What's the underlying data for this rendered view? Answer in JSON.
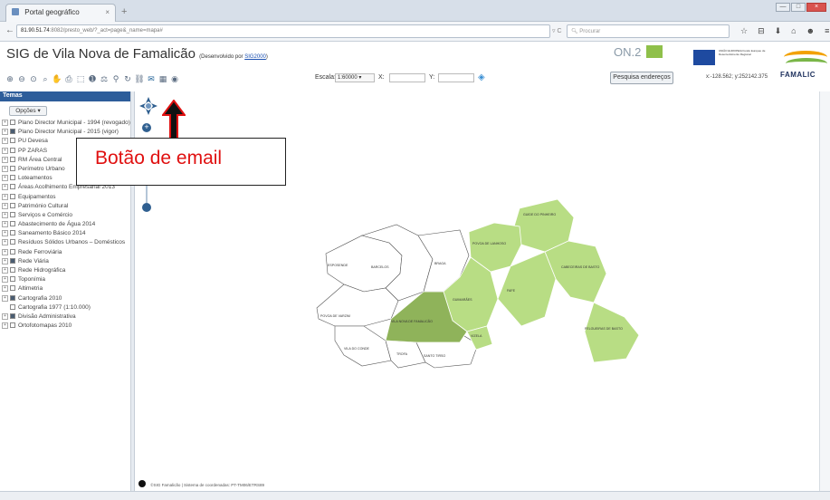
{
  "browser": {
    "tab_title": "Portal geográfico",
    "tab_close": "×",
    "new_tab": "+",
    "back": "←",
    "url_host": "81.90.51.74",
    "url_rest": ":8082/presto_web/?_act=page&_name=mapa#",
    "reload": "▿ C",
    "search_placeholder": "Procurar",
    "nav_icons": [
      "☆",
      "⊟",
      "⬇",
      "⌂",
      "☻",
      "≡"
    ],
    "window_controls": [
      "—",
      "□",
      "×"
    ]
  },
  "header": {
    "title": "SIG de Vila Nova de Famalicão",
    "credit_prefix": "(Desenvolvido por ",
    "credit_link": "SIG2000",
    "credit_suffix": ")",
    "logo_on2": "ON.2",
    "eu_text": "UNIÃO EUROPEIA Fundo Europeu de Desenvolvimento Regional",
    "famalicao_logo_text": "FAMALIC"
  },
  "toolbar": {
    "tools": [
      {
        "name": "zoom-in-tool",
        "glyph": "⊕"
      },
      {
        "name": "zoom-out-tool",
        "glyph": "⊖"
      },
      {
        "name": "zoom-extent-tool",
        "glyph": "⊙"
      },
      {
        "name": "zoom-window-tool",
        "glyph": "⌕"
      },
      {
        "name": "pan-tool",
        "glyph": "✋"
      },
      {
        "name": "print-tool",
        "glyph": "⎙"
      },
      {
        "name": "layer-tool",
        "glyph": "⬚"
      },
      {
        "name": "info-tool",
        "glyph": "➊"
      },
      {
        "name": "measure-tool",
        "glyph": "⚖"
      },
      {
        "name": "marker-tool",
        "glyph": "⚲"
      },
      {
        "name": "refresh-tool",
        "glyph": "↻"
      },
      {
        "name": "link-tool",
        "glyph": "⛓"
      },
      {
        "name": "email-tool",
        "glyph": "✉"
      },
      {
        "name": "export-tool",
        "glyph": "▦"
      },
      {
        "name": "globe-tool",
        "glyph": "◉"
      }
    ],
    "scale_label": "Escala:",
    "scale_value": "1:60000",
    "x_label": "X:",
    "y_label": "Y:",
    "go_icon": "◈",
    "address_button": "Pesquisa endereços",
    "coords": "x:-128.562; y:252142.375"
  },
  "panel": {
    "title": "Temas",
    "options_button": "Opções ▾",
    "layers": [
      {
        "label": "Plano Director Municipal - 1994 (revogado)",
        "checked": false,
        "expandable": true
      },
      {
        "label": "Plano Director Municipal - 2015 (vigor)",
        "checked": true,
        "expandable": true
      },
      {
        "label": "PU Devesa",
        "checked": false,
        "expandable": true
      },
      {
        "label": "PP ZARAS",
        "checked": false,
        "expandable": true
      },
      {
        "label": "RM Área Central",
        "checked": false,
        "expandable": true
      },
      {
        "label": "Perímetro Urbano",
        "checked": false,
        "expandable": true
      },
      {
        "label": "Loteamentos",
        "checked": false,
        "expandable": true
      },
      {
        "label": "Áreas Acolhimento Empresarial 2013",
        "checked": false,
        "expandable": true
      },
      {
        "label": "Equipamentos",
        "checked": false,
        "expandable": true
      },
      {
        "label": "Património Cultural",
        "checked": false,
        "expandable": true
      },
      {
        "label": "Serviços e Comércio",
        "checked": false,
        "expandable": true
      },
      {
        "label": "Abastecimento de Água 2014",
        "checked": false,
        "expandable": true
      },
      {
        "label": "Saneamento Básico 2014",
        "checked": false,
        "expandable": true
      },
      {
        "label": "Resíduos Sólidos Urbanos – Domésticos",
        "checked": false,
        "expandable": true
      },
      {
        "label": "Rede Ferroviária",
        "checked": false,
        "expandable": true
      },
      {
        "label": "Rede Viária",
        "checked": true,
        "expandable": true
      },
      {
        "label": "Rede Hidrográfica",
        "checked": false,
        "expandable": true
      },
      {
        "label": "Toponímia",
        "checked": false,
        "expandable": true
      },
      {
        "label": "Altimetria",
        "checked": false,
        "expandable": true
      },
      {
        "label": "Cartografia 2010",
        "checked": true,
        "expandable": true
      },
      {
        "label": "Cartografia 1977 (1:10.000)",
        "checked": false,
        "expandable": false
      },
      {
        "label": "Divisão Administrativa",
        "checked": true,
        "expandable": true
      },
      {
        "label": "Ortofotomapas 2010",
        "checked": false,
        "expandable": true
      }
    ]
  },
  "map": {
    "callout_text": "Botão de email",
    "footer_text": "©SIG Famalicão | Sistema de coordenadas: PT-TM06/ETRS89",
    "highlight_color": "#8fb35a",
    "region_color": "#b8dd84",
    "labels": [
      "GUIDE DO PINHEIRO",
      "POVOA DE LANHOSO",
      "ESPOSENDE",
      "BARCELOS",
      "BRAGA",
      "GUIMARÃES",
      "FAFE",
      "CABECEIRAS DE BASTO",
      "POVOA DE VARZIM",
      "VILA NOVA DE FAMALICÃO",
      "VIZELA",
      "FELGUEIRAS DE BASTO",
      "VILA DO CONDE",
      "TROFA",
      "SANTO TIRSO"
    ]
  }
}
